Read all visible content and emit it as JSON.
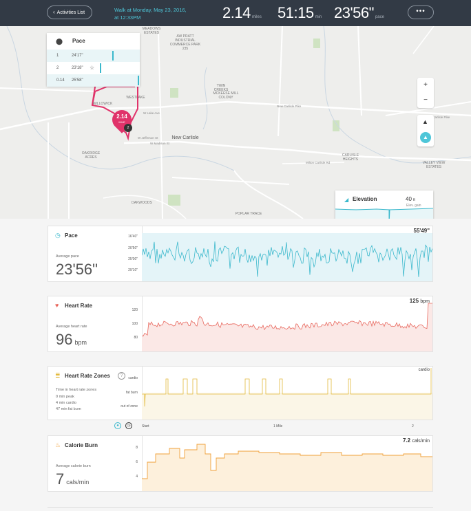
{
  "topbar": {
    "back_label": "Activities List",
    "walk_title_line1": "Walk at Monday, May 23, 2016,",
    "walk_title_line2": "at 12:33PM",
    "distance_value": "2.14",
    "distance_unit": "miles",
    "duration_value": "51:15",
    "duration_unit": "min",
    "pace_value": "23'56\"",
    "pace_unit": "pace",
    "more_label": "•••"
  },
  "map": {
    "labels": {
      "meadows_estates": "MEADOWS ESTATES",
      "aw_pratt": "AW PRATT INDUSTRIAL COMMERCE PARK 235",
      "twin_creeks": "TWIN CREEKS",
      "mckeese": "MCKEESE MILL COLONY",
      "new_carlisle": "New Carlisle",
      "oakridge": "OAKRIDGE ACRES",
      "carlisle_heights": "CARLISLE HEIGHTS",
      "valley_view": "VALLEY VIEW ESTATES",
      "dakwoods": "DAKWOODS",
      "poplar_trace": "POPLAR TRACE",
      "willowick": "WILLOWICK",
      "westlake": "WESTLAKE",
      "new_carlisle_pike": "New Carlisle Pike",
      "new_carlisle_pike2": "New Carlisle Pike",
      "milton_carlisle": "Milton Carlisle Rd",
      "w_lake_ave": "W Lake Ave",
      "w_madison": "W Madison St",
      "w_jefferson": "W Jefferson St"
    },
    "pin_value": "2.14",
    "pin_unit": "MILE",
    "pin_badge": "2"
  },
  "pace_table": {
    "title": "Pace",
    "rows": [
      {
        "n": "1",
        "v": "24'17\""
      },
      {
        "n": "2",
        "v": "23'18\""
      },
      {
        "n": "0.14",
        "v": "25'58\""
      }
    ]
  },
  "map_controls": {
    "zoom_in": "+",
    "zoom_out": "−"
  },
  "elevation": {
    "title": "Elevation",
    "value": "40",
    "unit": "ft",
    "sub": "Elev. gain",
    "tick_top": "500",
    "tick_bottom": "0"
  },
  "cards": {
    "pace": {
      "title": "Pace",
      "sub": "Average pace",
      "big": "23'56\"",
      "max": "55'49\"",
      "ticks": [
        "16'40\"",
        "20'50\"",
        "25'00\"",
        "29'10\""
      ]
    },
    "heart": {
      "title": "Heart Rate",
      "sub": "Average heart rate",
      "big": "96",
      "unit": "bpm",
      "max": "125",
      "max_unit": "bpm",
      "ticks": [
        "120",
        "100",
        "80"
      ]
    },
    "zones": {
      "title": "Heart Rate Zones",
      "sub": "Time in heart rate zones",
      "line1": "0 min peak",
      "line2": "4 min cardio",
      "line3": "47 min fat burn",
      "ticks": [
        "cardio",
        "fat burn",
        "out of zone"
      ],
      "top_label": "cardio",
      "help": "?"
    },
    "calorie": {
      "title": "Calorie Burn",
      "sub": "Average calorie burn",
      "big": "7",
      "unit": "cals/min",
      "max": "7.2",
      "max_unit": "cals/min",
      "ticks": [
        "8",
        "6",
        "4"
      ]
    }
  },
  "xaxis": {
    "start": "Start",
    "mile1": "1 Mile",
    "mile2": "2"
  },
  "colors": {
    "topbar": "#323a45",
    "accent": "#4ec6d8",
    "pace": "#3ab8cc",
    "heart": "#e8675d",
    "zones": "#e2b93b",
    "calorie": "#f0a13a",
    "route": "#e0336a"
  }
}
